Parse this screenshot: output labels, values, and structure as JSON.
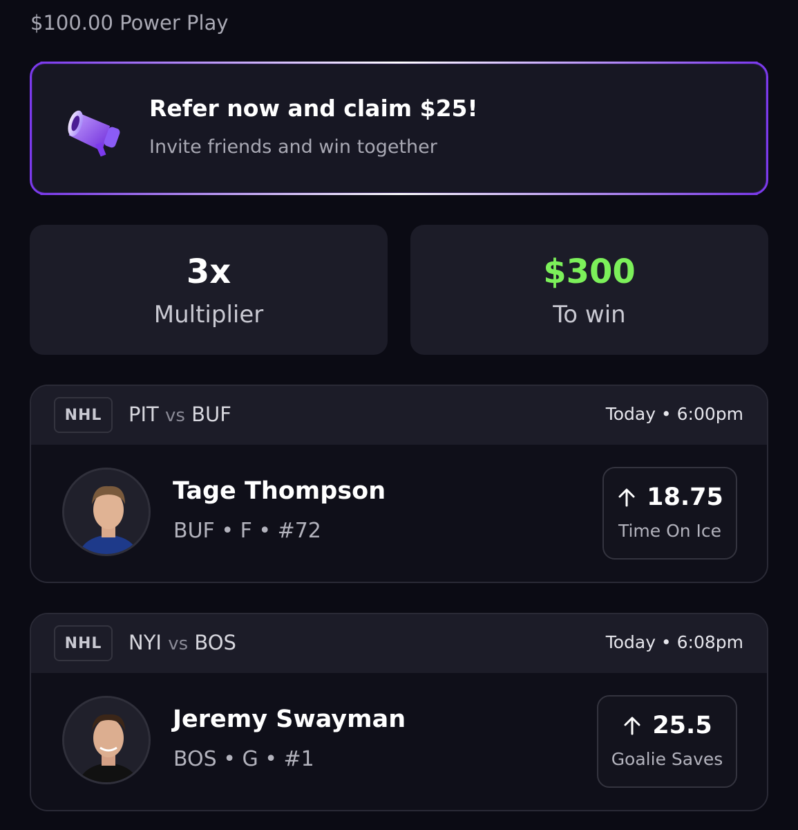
{
  "header": {
    "title": "$100.00 Power Play"
  },
  "promo": {
    "title": "Refer now and claim $25!",
    "subtitle": "Invite friends and win together",
    "icon": "megaphone-icon"
  },
  "stats": {
    "multiplier_value": "3x",
    "multiplier_label": "Multiplier",
    "payout_value": "$300",
    "payout_label": "To win",
    "payout_color": "#7cf05a"
  },
  "picks": [
    {
      "league": "NHL",
      "team_a": "PIT",
      "vs": "vs",
      "team_b": "BUF",
      "time": "Today • 6:00pm",
      "player_name": "Tage Thompson",
      "player_info": "BUF • F • #72",
      "direction_icon": "arrow-up-icon",
      "line_value": "18.75",
      "line_stat": "Time On Ice"
    },
    {
      "league": "NHL",
      "team_a": "NYI",
      "vs": "vs",
      "team_b": "BOS",
      "time": "Today • 6:08pm",
      "player_name": "Jeremy Swayman",
      "player_info": "BOS • G • #1",
      "direction_icon": "arrow-up-icon",
      "line_value": "25.5",
      "line_stat": "Goalie Saves"
    }
  ],
  "colors": {
    "background": "#0b0b14",
    "card": "#1c1c28",
    "accent": "#7c3aed",
    "positive": "#7cf05a"
  }
}
